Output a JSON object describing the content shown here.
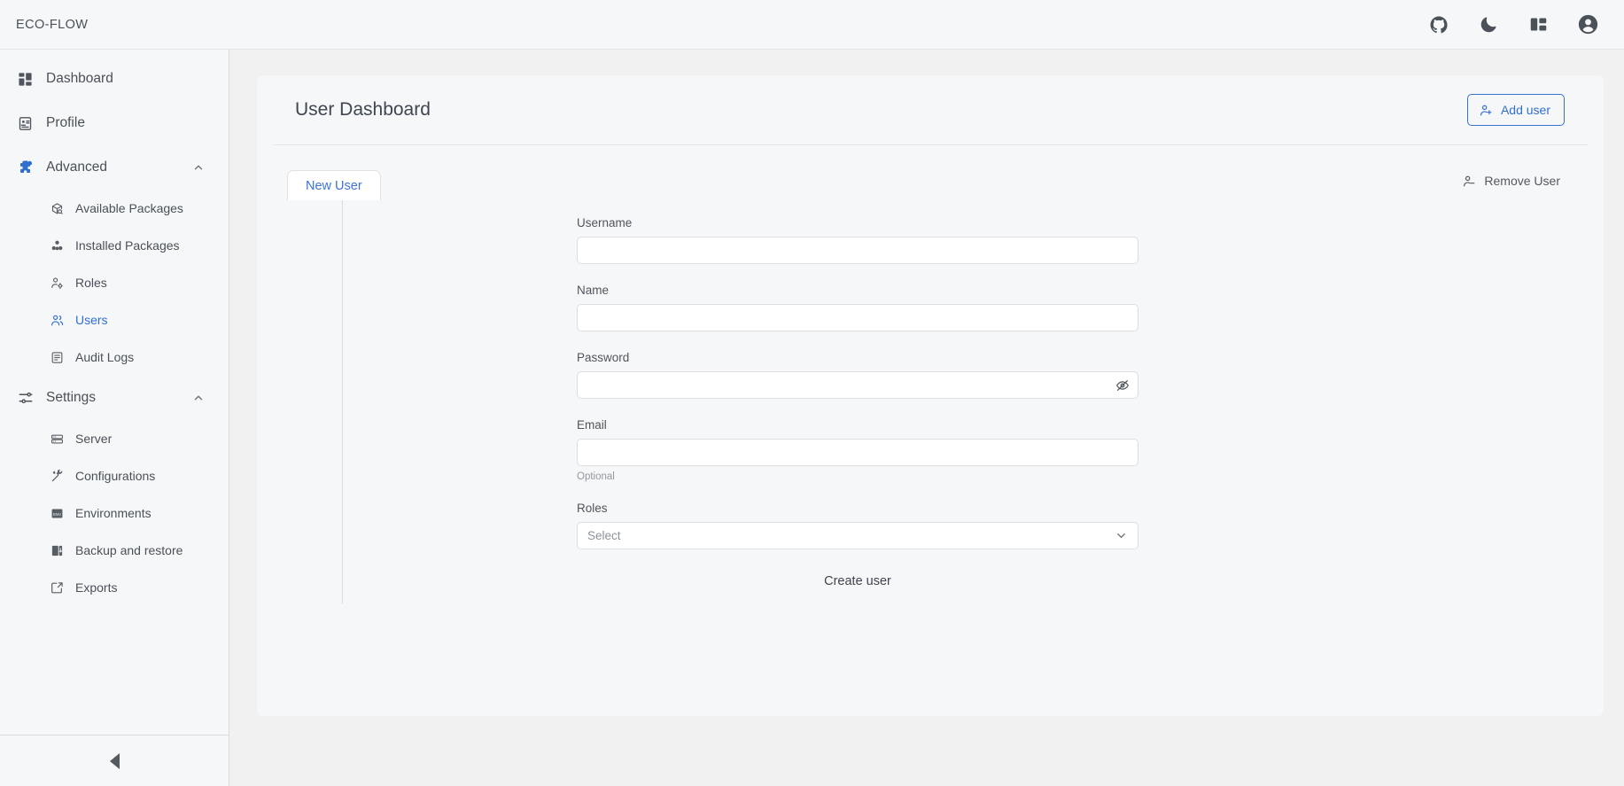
{
  "header": {
    "brand": "ECO-FLOW",
    "icons": [
      {
        "name": "github-icon",
        "label": "GitHub"
      },
      {
        "name": "moon-icon",
        "label": "Dark mode"
      },
      {
        "name": "layout-panel-icon",
        "label": "Toggle layout"
      },
      {
        "name": "account-circle-icon",
        "label": "Account"
      }
    ]
  },
  "sidebar": {
    "items": [
      {
        "label": "Dashboard",
        "icon": "dashboard-grid-icon",
        "type": "item"
      },
      {
        "label": "Profile",
        "icon": "id-card-icon",
        "type": "item"
      },
      {
        "label": "Advanced",
        "icon": "puzzle-gear-icon",
        "type": "group",
        "expanded": true,
        "active": true
      },
      {
        "label": "Available Packages",
        "icon": "package-search-icon",
        "type": "sub"
      },
      {
        "label": "Installed Packages",
        "icon": "packages-icon",
        "type": "sub"
      },
      {
        "label": "Roles",
        "icon": "user-cog-icon",
        "type": "sub"
      },
      {
        "label": "Users",
        "icon": "users-icon",
        "type": "sub",
        "active": true
      },
      {
        "label": "Audit Logs",
        "icon": "log-file-icon",
        "type": "sub"
      },
      {
        "label": "Settings",
        "icon": "sliders-icon",
        "type": "group",
        "expanded": true
      },
      {
        "label": "Server",
        "icon": "server-icon",
        "type": "sub"
      },
      {
        "label": "Configurations",
        "icon": "tools-icon",
        "type": "sub"
      },
      {
        "label": "Environments",
        "icon": "env-file-icon",
        "type": "sub"
      },
      {
        "label": "Backup and restore",
        "icon": "database-backup-icon",
        "type": "sub"
      },
      {
        "label": "Exports",
        "icon": "export-icon",
        "type": "sub"
      }
    ],
    "collapse_icon": "triangle-left-icon"
  },
  "main": {
    "page_title": "User Dashboard",
    "add_user_label": "Add user",
    "add_user_icon": "user-plus-icon",
    "remove_user_label": "Remove User",
    "remove_user_icon": "user-minus-icon",
    "tabs": [
      {
        "label": "New User",
        "active": true
      }
    ],
    "form": {
      "fields": [
        {
          "name": "username",
          "label": "Username",
          "value": "",
          "placeholder": "",
          "type": "text"
        },
        {
          "name": "name",
          "label": "Name",
          "value": "",
          "placeholder": "",
          "type": "text"
        },
        {
          "name": "password",
          "label": "Password",
          "value": "",
          "placeholder": "",
          "type": "password",
          "toggle_icon": "eye-off-icon"
        },
        {
          "name": "email",
          "label": "Email",
          "value": "",
          "placeholder": "",
          "type": "text",
          "hint": "Optional"
        },
        {
          "name": "roles",
          "label": "Roles",
          "value": "",
          "placeholder": "Select",
          "type": "select",
          "chevron_icon": "chevron-down-icon"
        }
      ],
      "submit_label": "Create user"
    }
  },
  "colors": {
    "accent": "#2f6fd0",
    "tab_text": "#3f73d8",
    "body_bg": "#f1f1f1",
    "panel_bg": "#f6f7f8",
    "border": "#dcdee1"
  }
}
